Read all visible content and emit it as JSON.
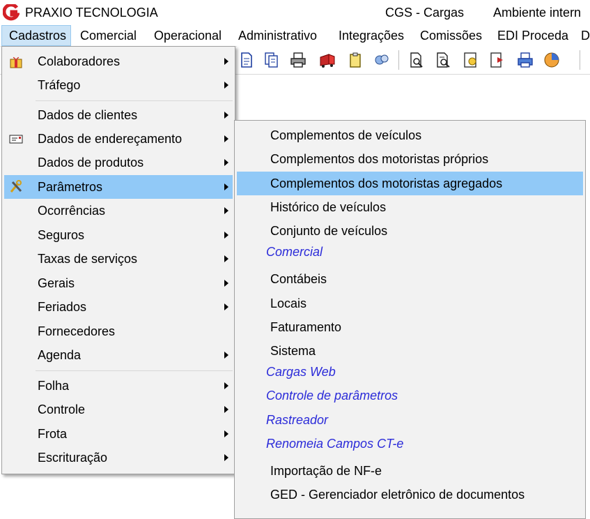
{
  "titlebar": {
    "app_title": "PRAXIO TECNOLOGIA",
    "module": "CGS - Cargas",
    "environment": "Ambiente intern"
  },
  "menubar": {
    "items": [
      "Cadastros",
      "Comercial",
      "Operacional",
      "Administrativo",
      "Integrações",
      "Comissões",
      "EDI Proceda",
      "D"
    ]
  },
  "toolbar": {
    "icons": [
      "document-icon",
      "documents-icon",
      "printer-icon",
      "truck-icon",
      "clipboard-icon",
      "network-icon",
      "preview-icon",
      "report-search-icon",
      "certificate-icon",
      "export-icon",
      "print-icon",
      "pie-chart-icon"
    ]
  },
  "cadastros_menu": {
    "items": [
      {
        "label": "Colaboradores",
        "icon": "gift-icon",
        "submenu": true
      },
      {
        "label": "Tráfego",
        "submenu": true
      },
      {
        "label": "Dados de clientes",
        "submenu": true
      },
      {
        "label": "Dados de endereçamento",
        "icon": "envelope-icon",
        "submenu": true
      },
      {
        "label": "Dados de produtos",
        "submenu": true
      },
      {
        "label": "Parâmetros",
        "icon": "tools-icon",
        "submenu": true,
        "highlighted": true
      },
      {
        "label": "Ocorrências",
        "submenu": true
      },
      {
        "label": "Seguros",
        "submenu": true
      },
      {
        "label": "Taxas de serviços",
        "submenu": true
      },
      {
        "label": "Gerais",
        "submenu": true
      },
      {
        "label": "Feriados",
        "submenu": true
      },
      {
        "label": "Fornecedores",
        "submenu": false
      },
      {
        "label": "Agenda",
        "submenu": true
      },
      {
        "label": "Folha",
        "submenu": true
      },
      {
        "label": "Controle",
        "submenu": true
      },
      {
        "label": "Frota",
        "submenu": true
      },
      {
        "label": "Escrituração",
        "submenu": true
      }
    ]
  },
  "parametros_submenu": {
    "items": [
      {
        "label": "Complementos de veículos"
      },
      {
        "label": "Complementos dos motoristas próprios"
      },
      {
        "label": "Complementos dos motoristas agregados",
        "highlighted": true
      },
      {
        "label": "Histórico de veículos"
      },
      {
        "label": "Conjunto de veículos"
      },
      {
        "label": "Comercial",
        "group": true
      },
      {
        "label": "Contábeis"
      },
      {
        "label": "Locais"
      },
      {
        "label": "Faturamento"
      },
      {
        "label": "Sistema"
      },
      {
        "label": "Cargas Web",
        "group": true
      },
      {
        "label": "Controle de parâmetros",
        "group": true
      },
      {
        "label": "Rastreador",
        "group": true
      },
      {
        "label": "Renomeia Campos CT-e",
        "group": true
      },
      {
        "label": "Importação de NF-e"
      },
      {
        "label": "GED - Gerenciador eletrônico de documentos"
      }
    ]
  },
  "colors": {
    "highlight": "#91c9f7",
    "menu_bg": "#f2f2f2",
    "group_link": "#2b2bd9",
    "brand_red": "#d32027"
  }
}
